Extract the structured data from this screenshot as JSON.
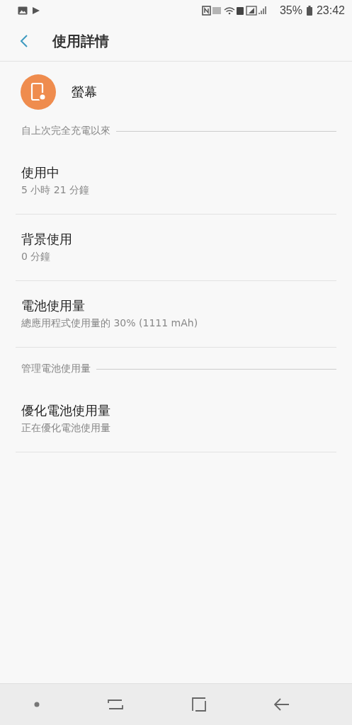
{
  "status_bar": {
    "battery": "35%",
    "time": "23:42"
  },
  "header": {
    "title": "使用詳情"
  },
  "app": {
    "name": "螢幕"
  },
  "sections": [
    {
      "title": "自上次完全充電以來",
      "items": [
        {
          "title": "使用中",
          "subtitle": "5 小時 21 分鐘"
        },
        {
          "title": "背景使用",
          "subtitle": "0 分鐘"
        },
        {
          "title": "電池使用量",
          "subtitle": "總應用程式使用量的 30% (1111 mAh)"
        }
      ]
    },
    {
      "title": "管理電池使用量",
      "items": [
        {
          "title": "優化電池使用量",
          "subtitle": "正在優化電池使用量"
        }
      ]
    }
  ]
}
